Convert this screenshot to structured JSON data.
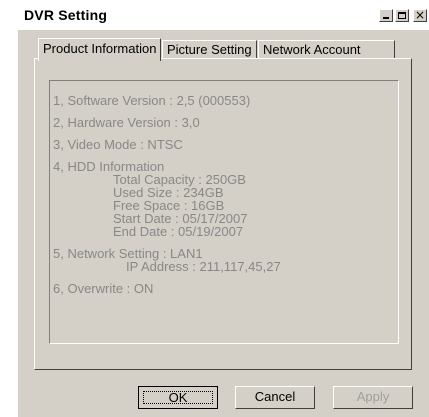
{
  "window": {
    "title": "DVR Setting"
  },
  "tabs": [
    {
      "label": "Product Information",
      "active": true
    },
    {
      "label": "Picture Setting",
      "active": false
    },
    {
      "label": "Network Account",
      "active": false
    }
  ],
  "info": {
    "software": "1, Software Version : 2,5 (000553)",
    "hardware": "2, Hardware Version : 3,0",
    "video_mode": "3, Video Mode : NTSC",
    "hdd_title": "4, HDD Information",
    "hdd": {
      "total": "Total Capacity : 250GB",
      "used": "Used Size : 234GB",
      "free": "Free Space : 16GB",
      "start": "Start Date : 05/17/2007",
      "end": "End Date : 05/19/2007"
    },
    "network": "5, Network Setting : LAN1",
    "ip": "IP Address : 211,117,45,27",
    "overwrite": "6, Overwrite : ON"
  },
  "buttons": {
    "ok": "OK",
    "cancel": "Cancel",
    "apply": "Apply"
  }
}
